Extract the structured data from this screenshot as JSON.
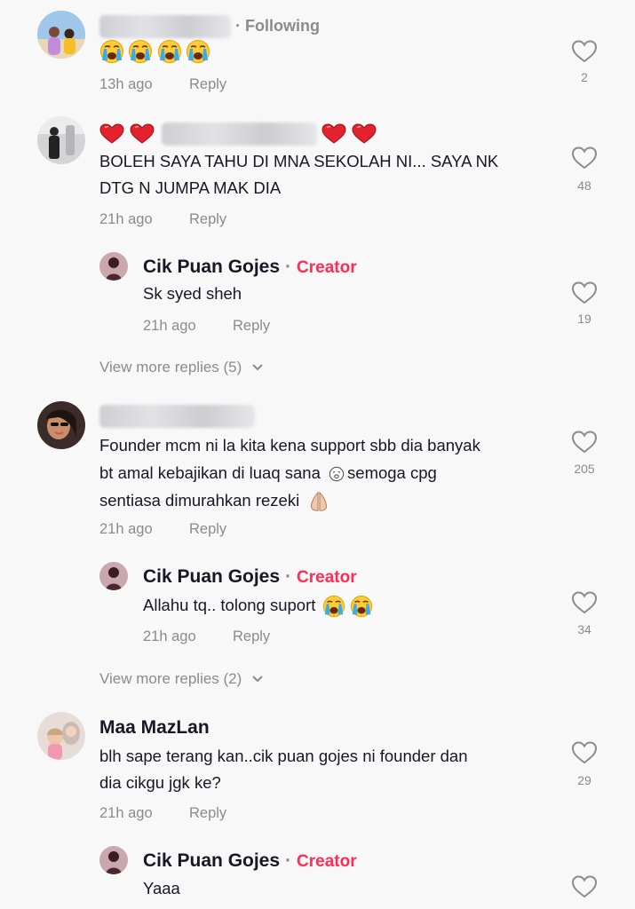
{
  "comments": [
    {
      "author": "",
      "follow_label": "Following",
      "text": "",
      "time": "13h ago",
      "reply_label": "Reply",
      "likes": "2"
    },
    {
      "author": "",
      "text_lines": [
        "BOLEH SAYA TAHU DI MNA SEKOLAH NI... SAYA NK",
        "DTG N JUMPA MAK DIA"
      ],
      "time": "21h ago",
      "reply_label": "Reply",
      "likes": "48",
      "replies": [
        {
          "author": "Cik Puan Gojes",
          "badge": "Creator",
          "text": "Sk syed sheh",
          "time": "21h ago",
          "reply_label": "Reply",
          "likes": "19"
        }
      ],
      "view_more": "View more replies (5)"
    },
    {
      "author": "",
      "text_lines": [
        "Founder mcm ni la kita kena support sbb dia banyak",
        "bt amal kebajikan di luaq sana",
        "sentiasa dimurahkan rezeki"
      ],
      "line2_suffix": "semoga cpg",
      "time": "21h ago",
      "reply_label": "Reply",
      "likes": "205",
      "replies": [
        {
          "author": "Cik Puan Gojes",
          "badge": "Creator",
          "text": "Allahu tq.. tolong suport",
          "time": "21h ago",
          "reply_label": "Reply",
          "likes": "34"
        }
      ],
      "view_more": "View more replies (2)"
    },
    {
      "author": "Maa MazLan",
      "text_lines": [
        "blh sape terang kan..cik puan gojes ni founder dan",
        "dia cikgu jgk ke?"
      ],
      "time": "21h ago",
      "reply_label": "Reply",
      "likes": "29",
      "replies": [
        {
          "author": "Cik Puan Gojes",
          "badge": "Creator",
          "text": "Yaaa"
        }
      ]
    }
  ],
  "icons": {
    "like": "heart-outline-icon",
    "chevron": "chevron-down-icon",
    "cry": "loudly-crying-face-emoji",
    "heart": "red-heart-emoji",
    "praying": "folded-hands-emoji",
    "weary": "weary-face-emoji"
  },
  "colors": {
    "creator": "#fe2c55",
    "secondary_text": "#8a8b91",
    "primary_text": "#161823",
    "background": "#f8f8f8"
  }
}
